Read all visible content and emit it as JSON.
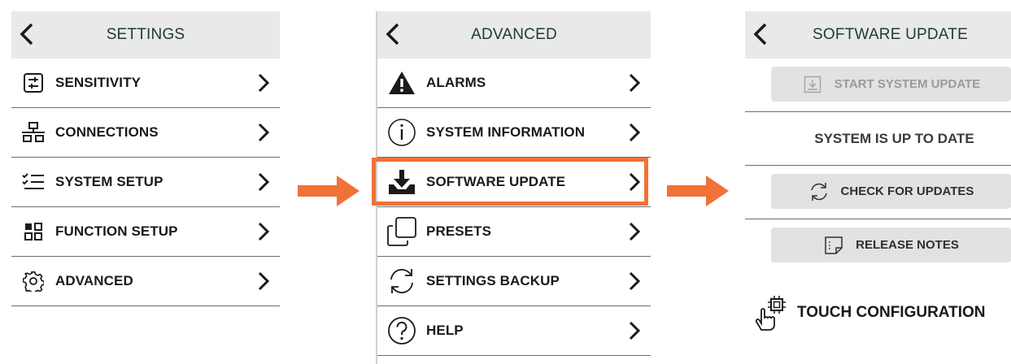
{
  "colors": {
    "accent": "#f07238",
    "header_bg": "#e9e9e9",
    "button_bg": "#e2e2e2"
  },
  "panel_settings": {
    "title": "SETTINGS",
    "items": [
      {
        "label": "SENSITIVITY",
        "icon": "sliders-icon"
      },
      {
        "label": "CONNECTIONS",
        "icon": "network-icon"
      },
      {
        "label": "SYSTEM SETUP",
        "icon": "checklist-icon"
      },
      {
        "label": "FUNCTION SETUP",
        "icon": "grid-icon"
      },
      {
        "label": "ADVANCED",
        "icon": "gear-icon"
      }
    ]
  },
  "panel_advanced": {
    "title": "ADVANCED",
    "items": [
      {
        "label": "ALARMS",
        "icon": "warning-icon"
      },
      {
        "label": "SYSTEM INFORMATION",
        "icon": "info-icon"
      },
      {
        "label": "SOFTWARE UPDATE",
        "icon": "download-icon"
      },
      {
        "label": "PRESETS",
        "icon": "copy-icon"
      },
      {
        "label": "SETTINGS BACKUP",
        "icon": "sync-icon"
      },
      {
        "label": "HELP",
        "icon": "help-icon"
      }
    ]
  },
  "panel_software_update": {
    "title": "SOFTWARE UPDATE",
    "start_update_label": "START SYSTEM UPDATE",
    "status_text": "SYSTEM IS UP TO DATE",
    "check_updates_label": "CHECK FOR UPDATES",
    "release_notes_label": "RELEASE NOTES",
    "touch_config_label": "TOUCH CONFIGURATION"
  }
}
